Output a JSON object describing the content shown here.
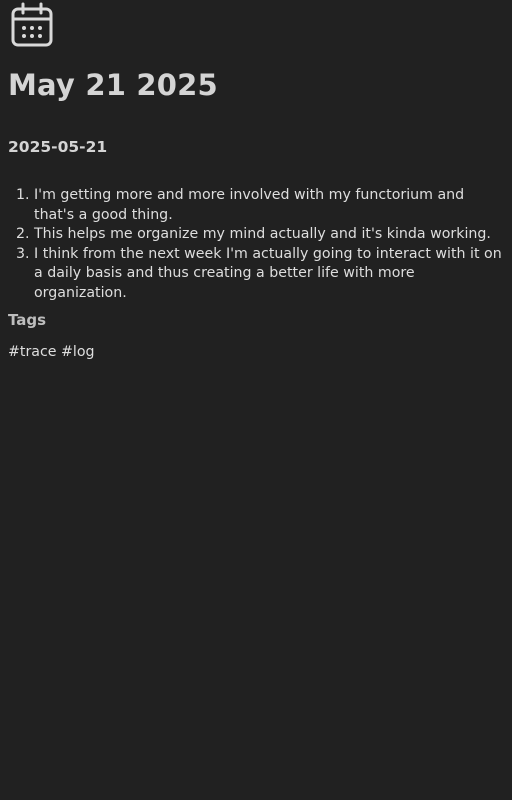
{
  "page": {
    "icon": "calendar-icon",
    "title": "May 21 2025",
    "date_heading": "2025-05-21"
  },
  "entries": [
    "I'm getting more and more involved with my functorium and that's a good thing.",
    "This helps me organize my mind actually and it's kinda working.",
    "I think from the next week I'm actually going to interact with it on a daily basis and thus creating a better life with more organization."
  ],
  "tags": {
    "heading": "Tags",
    "items": [
      "#trace",
      "#log"
    ]
  },
  "colors": {
    "background": "#212121",
    "text": "#dedede",
    "heading": "#d4d4d4",
    "muted_heading": "#bdbdbd"
  }
}
